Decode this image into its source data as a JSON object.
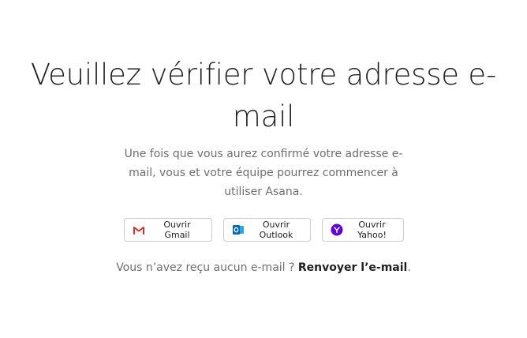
{
  "main": {
    "title": "Veuillez vérifier votre adresse e-mail",
    "subtitle": "Une fois que vous aurez confirmé votre adresse e-mail, vous et votre équipe pourrez commencer à utiliser Asana.",
    "buttons": {
      "gmail": {
        "label": "Ouvrir Gmail",
        "icon": "gmail-icon"
      },
      "outlook": {
        "label": "Ouvrir Outlook",
        "icon": "outlook-icon"
      },
      "yahoo": {
        "label": "Ouvrir Yahoo!",
        "icon": "yahoo-icon"
      }
    },
    "footer": {
      "prompt": "Vous n’avez reçu aucun e-mail ?",
      "resend_link": "Renvoyer l’e-mail",
      "trailing": "."
    }
  },
  "colors": {
    "text_primary": "#1e1f21",
    "text_secondary": "#6d6e6f",
    "button_border": "#cfcbcb",
    "gmail_red": "#d93025",
    "outlook_blue": "#0a64b4",
    "yahoo_purple": "#6001d2"
  }
}
